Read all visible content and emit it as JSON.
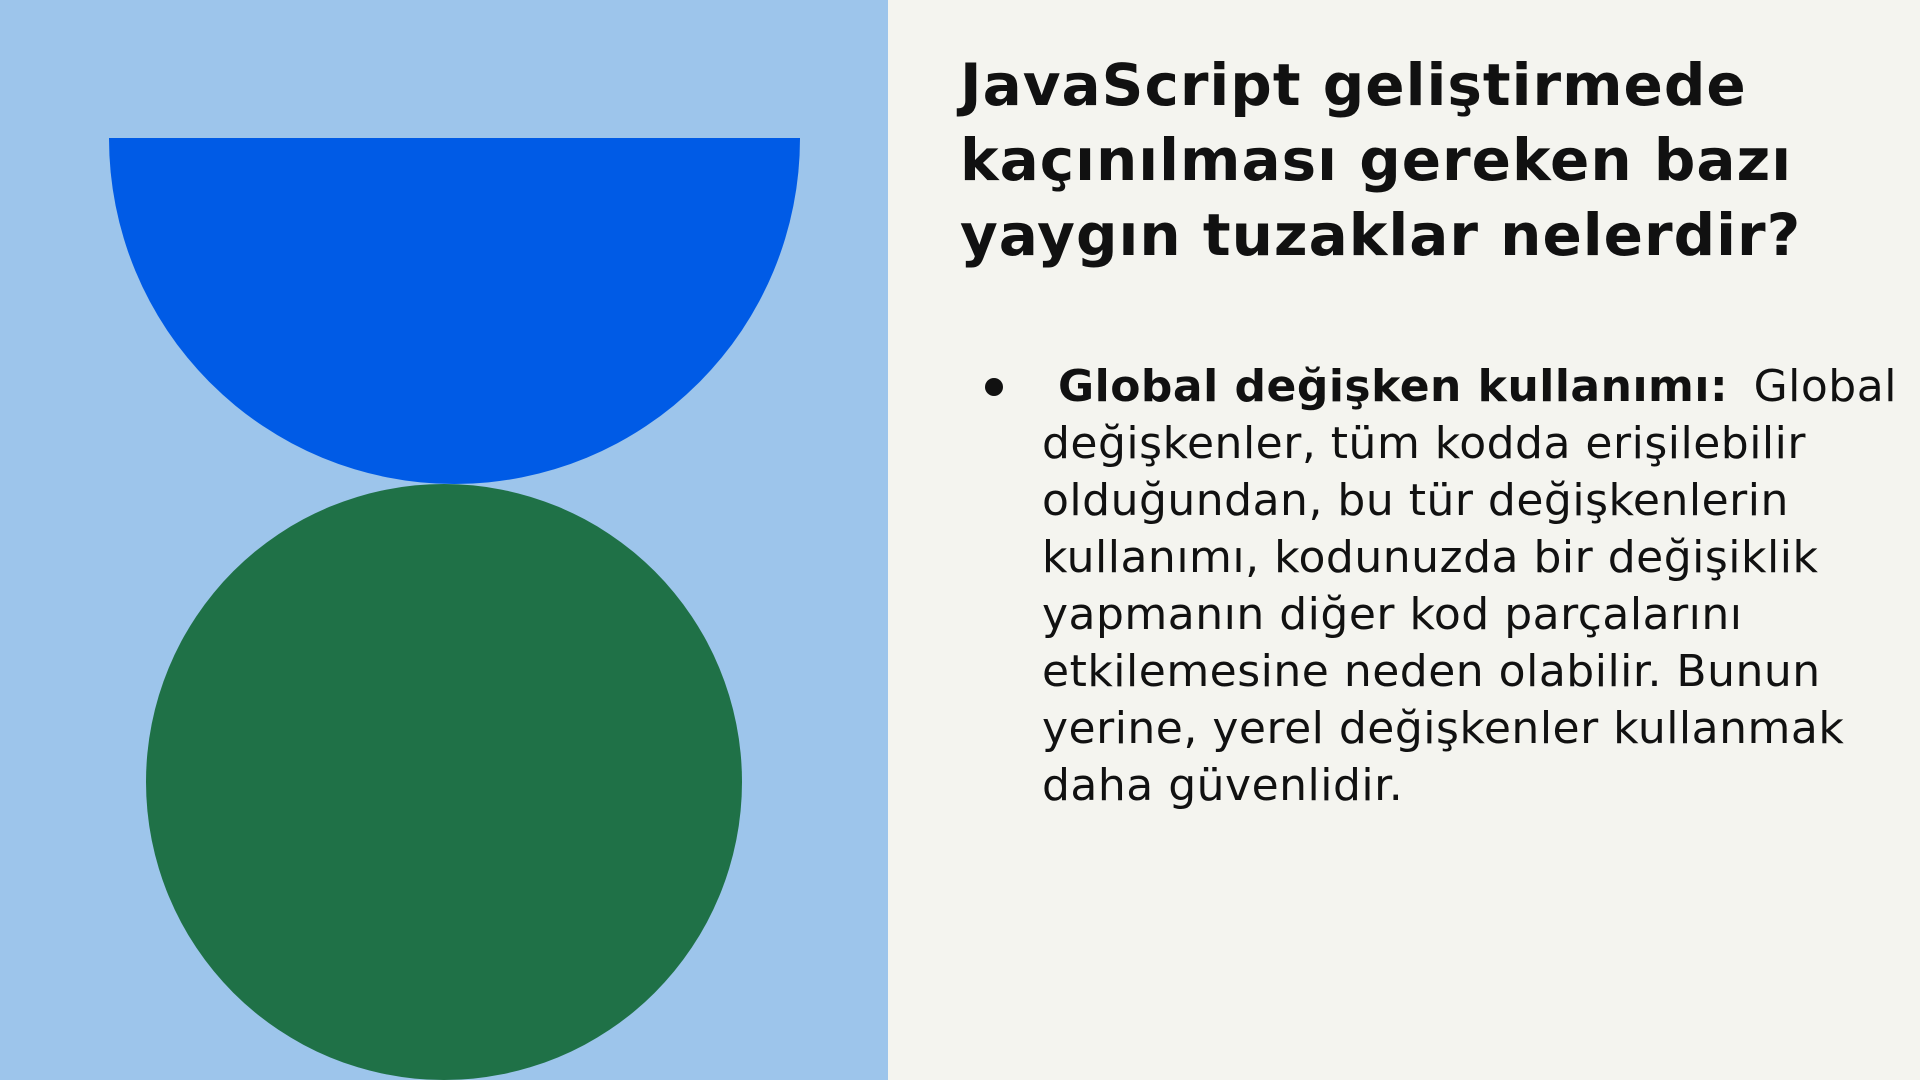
{
  "slide": {
    "title": "JavaScript geliştirmede kaçınılması gereken bazı yaygın tuzaklar nelerdir?",
    "bullets": [
      {
        "term": "Global değişken kullanımı:",
        "text": "Global değişkenler, tüm kodda erişilebilir olduğundan, bu tür değişkenlerin kullanımı, kodunuzda bir değişiklik yapmanın diğer kod parçalarını etkilemesine neden olabilir. Bunun yerine, yerel değişkenler kullanmak daha güvenlidir."
      }
    ]
  },
  "colors": {
    "art_background": "#9DC5EB",
    "half_circle": "#005BE6",
    "full_circle": "#1F7147",
    "content_background": "#F4F4EF",
    "text": "#111111"
  }
}
